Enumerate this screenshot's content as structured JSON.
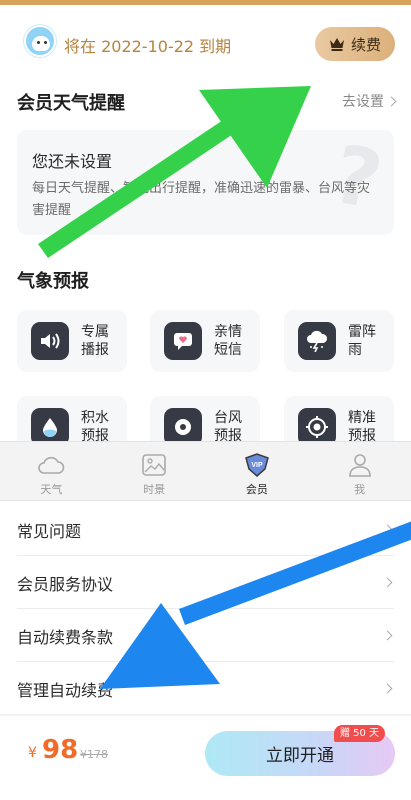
{
  "header": {
    "expire_text": "将在 2022-10-22 到期",
    "renew_label": "续费"
  },
  "weather_alert": {
    "title": "会员天气提醒",
    "set_link": "去设置",
    "card_title": "您还未设置",
    "card_desc": "每日天气提醒、智能出行提醒，准确迅速的雷暴、台风等灾害提醒"
  },
  "forecast": {
    "title": "气象预报",
    "tiles": [
      {
        "label": "专属播报",
        "icon": "speaker-icon"
      },
      {
        "label": "亲情短信",
        "icon": "heart-message-icon"
      },
      {
        "label": "雷阵雨",
        "icon": "thunderstorm-icon"
      },
      {
        "label": "积水预报",
        "icon": "water-drop-icon"
      },
      {
        "label": "台风预报",
        "icon": "typhoon-icon"
      },
      {
        "label": "精准预报",
        "icon": "target-icon"
      }
    ]
  },
  "tabbar": {
    "tabs": [
      {
        "label": "天气",
        "icon": "cloud-icon",
        "active": false
      },
      {
        "label": "时景",
        "icon": "picture-icon",
        "active": false
      },
      {
        "label": "会员",
        "icon": "vip-icon",
        "active": true
      },
      {
        "label": "我",
        "icon": "person-icon",
        "active": false
      }
    ]
  },
  "list": {
    "items": [
      {
        "label": "常见问题"
      },
      {
        "label": "会员服务协议"
      },
      {
        "label": "自动续费条款"
      },
      {
        "label": "管理自动续费"
      }
    ]
  },
  "purchase": {
    "currency": "¥",
    "price": "98",
    "original_price": "¥178",
    "open_label": "立即开通",
    "gift_badge": "赠 50 天"
  },
  "colors": {
    "accent_gold": "#b7833f",
    "price_orange": "#f06a2a",
    "arrow_green": "#36d14a",
    "arrow_blue": "#1e86ef"
  }
}
